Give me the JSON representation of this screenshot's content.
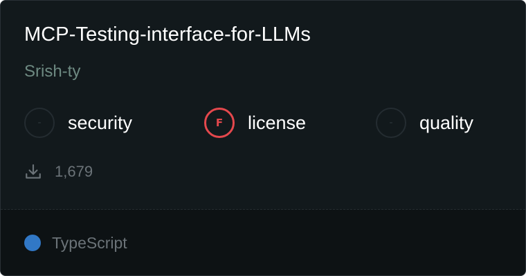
{
  "repo": {
    "name": "MCP-Testing-interface-for-LLMs",
    "author": "Srish-ty"
  },
  "scores": [
    {
      "label": "security",
      "grade": "-",
      "status": "none"
    },
    {
      "label": "license",
      "grade": "F",
      "status": "fail"
    },
    {
      "label": "quality",
      "grade": "-",
      "status": "none"
    }
  ],
  "downloads": {
    "icon": "download-icon",
    "count": "1,679"
  },
  "language": {
    "name": "TypeScript",
    "color": "#3178c6"
  },
  "colors": {
    "card_bg": "#12191c",
    "footer_bg": "#0d1214",
    "fail": "#e5484d",
    "author": "#6e8a82"
  }
}
